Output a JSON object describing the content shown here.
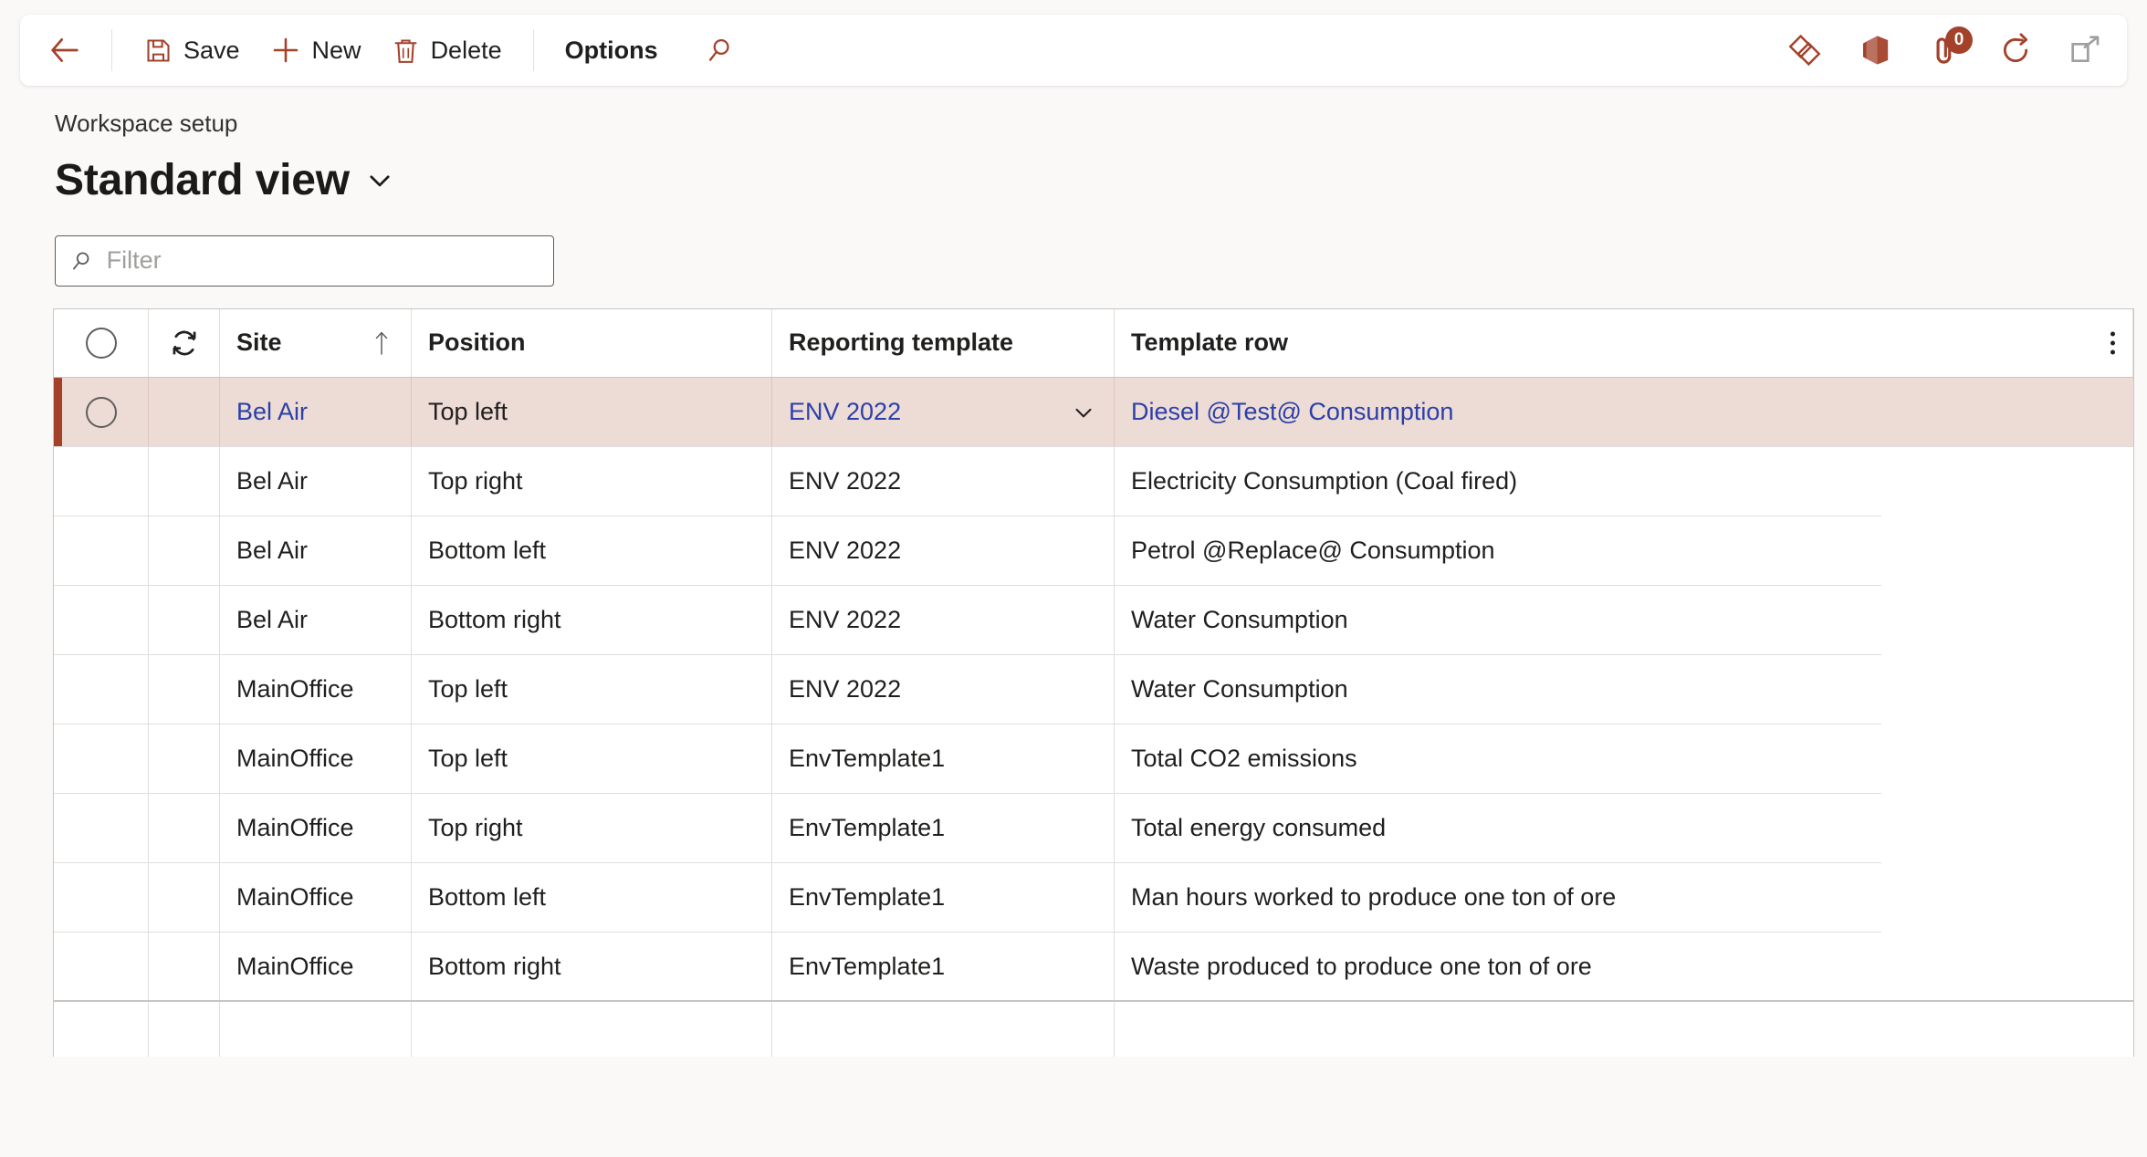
{
  "theme": {
    "accent": "#a4412a",
    "link": "#2b40a8",
    "selected_row_bg": "#eddbd5",
    "page_bg": "#faf9f8",
    "grid_border": "#c8c6c4"
  },
  "toolbar": {
    "back_label": "Back",
    "save_label": "Save",
    "new_label": "New",
    "delete_label": "Delete",
    "options_label": "Options",
    "search_label": "Search",
    "icons": {
      "back": "arrow-left-icon",
      "save": "floppy-disk-icon",
      "new": "plus-icon",
      "delete": "trash-icon",
      "search": "search-icon",
      "relationships": "diamond-relationships-icon",
      "office": "office-app-icon",
      "attachments": "paperclip-icon",
      "refresh": "refresh-circle-icon",
      "popout": "open-in-new-window-icon"
    },
    "attachment_count": "0"
  },
  "header": {
    "breadcrumb": "Workspace setup",
    "title": "Standard view",
    "title_chevron": "chevron-down-icon"
  },
  "filter": {
    "placeholder": "Filter",
    "value": "",
    "icon": "search-icon"
  },
  "grid": {
    "columns": [
      {
        "key": "select",
        "label": "",
        "icon": "select-all-circle-icon"
      },
      {
        "key": "sync",
        "label": "",
        "icon": "sync-icon"
      },
      {
        "key": "site",
        "label": "Site",
        "sort": "ascending",
        "sort_icon": "arrow-up-icon"
      },
      {
        "key": "position",
        "label": "Position"
      },
      {
        "key": "reporting_template",
        "label": "Reporting template"
      },
      {
        "key": "template_row",
        "label": "Template row"
      }
    ],
    "overflow_icon": "more-vertical-icon",
    "rows": [
      {
        "site": "Bel Air",
        "position": "Top left",
        "reporting_template": "ENV 2022",
        "template_row": "Diesel @Test@ Consumption",
        "selected": true,
        "lookup_icon": "chevron-down-icon"
      },
      {
        "site": "Bel Air",
        "position": "Top right",
        "reporting_template": "ENV 2022",
        "template_row": "Electricity Consumption (Coal fired)",
        "selected": false
      },
      {
        "site": "Bel Air",
        "position": "Bottom left",
        "reporting_template": "ENV 2022",
        "template_row": "Petrol @Replace@ Consumption",
        "selected": false
      },
      {
        "site": "Bel Air",
        "position": "Bottom right",
        "reporting_template": "ENV 2022",
        "template_row": "Water Consumption",
        "selected": false
      },
      {
        "site": "MainOffice",
        "position": "Top left",
        "reporting_template": "ENV 2022",
        "template_row": "Water Consumption",
        "selected": false
      },
      {
        "site": "MainOffice",
        "position": "Top left",
        "reporting_template": "EnvTemplate1",
        "template_row": "Total CO2 emissions",
        "selected": false
      },
      {
        "site": "MainOffice",
        "position": "Top right",
        "reporting_template": "EnvTemplate1",
        "template_row": "Total energy consumed",
        "selected": false
      },
      {
        "site": "MainOffice",
        "position": "Bottom left",
        "reporting_template": "EnvTemplate1",
        "template_row": "Man hours worked to produce one ton of ore",
        "selected": false
      },
      {
        "site": "MainOffice",
        "position": "Bottom right",
        "reporting_template": "EnvTemplate1",
        "template_row": "Waste produced to produce one ton of ore",
        "selected": false
      }
    ]
  }
}
